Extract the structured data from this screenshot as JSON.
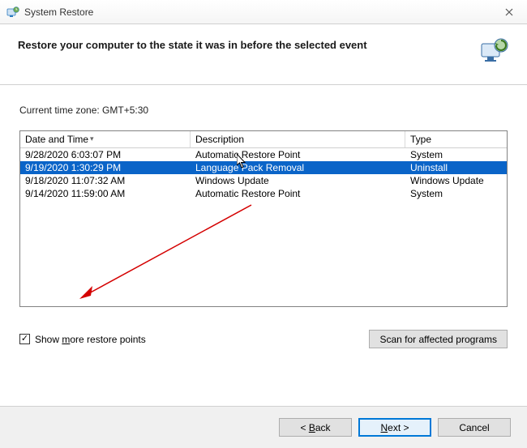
{
  "titlebar": {
    "title": "System Restore"
  },
  "header": {
    "text": "Restore your computer to the state it was in before the selected event"
  },
  "timezone_label": "Current time zone: GMT+5:30",
  "columns": {
    "datetime": "Date and Time",
    "description": "Description",
    "type": "Type"
  },
  "rows": [
    {
      "dt": "9/28/2020 6:03:07 PM",
      "desc": "Automatic Restore Point",
      "type": "System",
      "selected": false
    },
    {
      "dt": "9/19/2020 1:30:29 PM",
      "desc": "Language Pack Removal",
      "type": "Uninstall",
      "selected": true
    },
    {
      "dt": "9/18/2020 11:07:32 AM",
      "desc": "Windows Update",
      "type": "Windows Update",
      "selected": false
    },
    {
      "dt": "9/14/2020 11:59:00 AM",
      "desc": "Automatic Restore Point",
      "type": "System",
      "selected": false
    }
  ],
  "show_more": {
    "label_pre": "Show ",
    "label_u": "m",
    "label_post": "ore restore points",
    "checked": true
  },
  "scan_btn": "Scan for affected programs",
  "buttons": {
    "back_pre": "< ",
    "back_u": "B",
    "back_post": "ack",
    "next_u": "N",
    "next_post": "ext >",
    "cancel": "Cancel"
  },
  "colors": {
    "selection": "#0a64c8",
    "primary_border": "#0078d7"
  }
}
